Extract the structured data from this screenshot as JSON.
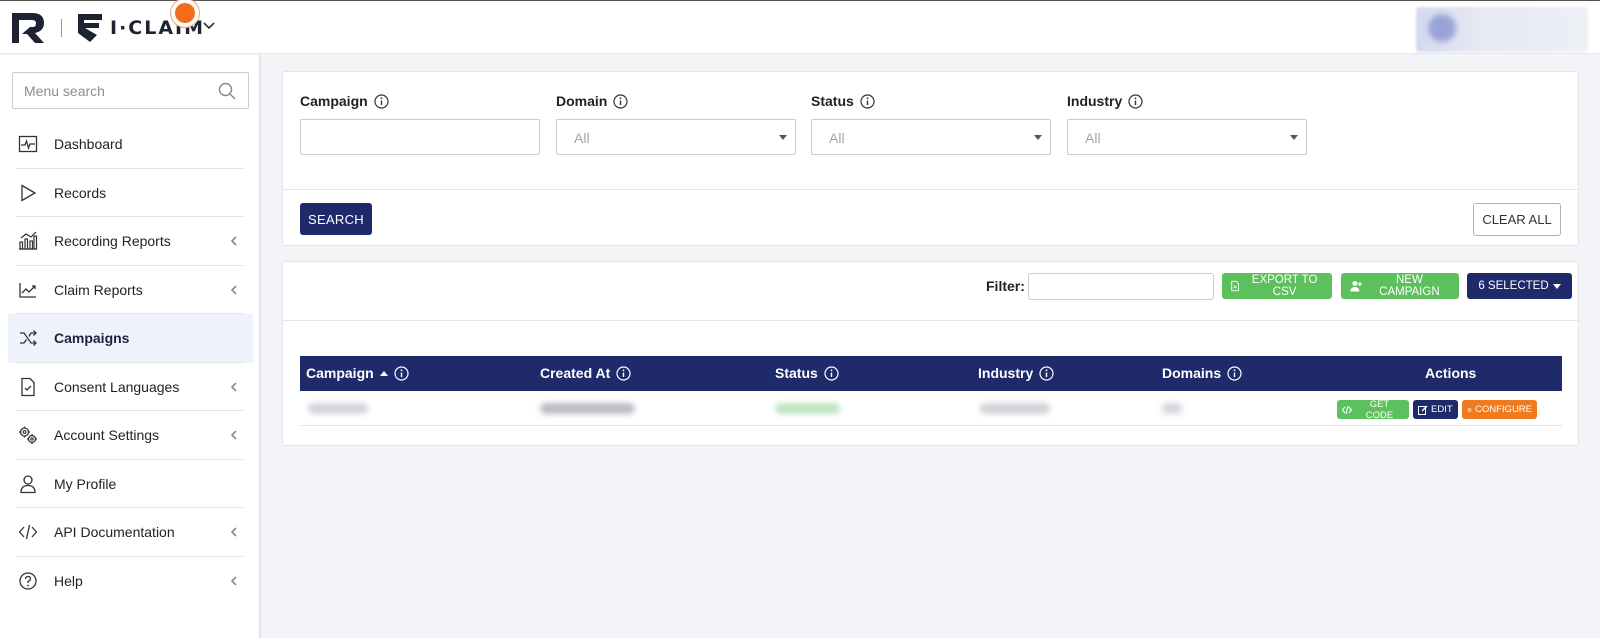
{
  "header": {
    "brand_text": "I·CLAIM"
  },
  "sidebar": {
    "search_placeholder": "Menu search",
    "items": [
      {
        "label": "Dashboard",
        "icon": "dashboard-icon",
        "has_chevron": false
      },
      {
        "label": "Records",
        "icon": "play-icon",
        "has_chevron": false
      },
      {
        "label": "Recording Reports",
        "icon": "bar-chart-icon",
        "has_chevron": true
      },
      {
        "label": "Claim Reports",
        "icon": "line-chart-icon",
        "has_chevron": true
      },
      {
        "label": "Campaigns",
        "icon": "shuffle-icon",
        "has_chevron": false,
        "active": true
      },
      {
        "label": "Consent Languages",
        "icon": "document-check-icon",
        "has_chevron": true
      },
      {
        "label": "Account Settings",
        "icon": "gears-icon",
        "has_chevron": true
      },
      {
        "label": "My Profile",
        "icon": "user-icon",
        "has_chevron": false
      },
      {
        "label": "API Documentation",
        "icon": "code-icon",
        "has_chevron": true
      },
      {
        "label": "Help",
        "icon": "question-icon",
        "has_chevron": true
      }
    ]
  },
  "filters": {
    "campaign": {
      "label": "Campaign",
      "value": ""
    },
    "domain": {
      "label": "Domain",
      "value": "All"
    },
    "status": {
      "label": "Status",
      "value": "All"
    },
    "industry": {
      "label": "Industry",
      "value": "All"
    },
    "search_label": "SEARCH",
    "clear_label": "CLEAR ALL"
  },
  "table_toolbar": {
    "filter_label": "Filter:",
    "export_label": "EXPORT TO CSV",
    "new_campaign_label": "NEW CAMPAIGN",
    "selected_label": "6 SELECTED"
  },
  "table": {
    "columns": [
      "Campaign",
      "Created At",
      "Status",
      "Industry",
      "Domains",
      "Actions"
    ],
    "row_actions": {
      "get_code": "GET CODE",
      "edit": "EDIT",
      "configure": "CONFIGURE"
    }
  },
  "colors": {
    "navy": "#1e2a6a",
    "green": "#5cc05c",
    "orange": "#f07a1e",
    "notification": "#f26c1a"
  }
}
